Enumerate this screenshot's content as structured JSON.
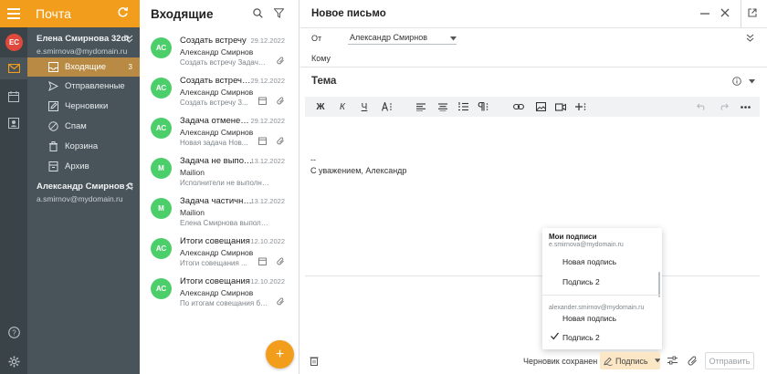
{
  "app": {
    "title": "Почта",
    "accent_color": "#f29d1b",
    "rail_initials": "ЕС"
  },
  "sidebar": {
    "accounts": [
      {
        "name": "Елена Смирнова 32dt",
        "email": "e.smirnova@mydomain.ru",
        "folders": [
          {
            "label": "Входящие",
            "count": "3",
            "icon": "inbox-icon"
          },
          {
            "label": "Отправленные",
            "icon": "send-icon"
          },
          {
            "label": "Черновики",
            "icon": "pencil-icon"
          },
          {
            "label": "Спам",
            "icon": "ban-icon"
          },
          {
            "label": "Корзина",
            "icon": "trash-icon"
          },
          {
            "label": "Архив",
            "icon": "archive-icon"
          }
        ]
      },
      {
        "name": "Александр Смирнов С",
        "email": "a.smirnov@mydomain.ru"
      }
    ]
  },
  "list": {
    "title": "Входящие",
    "messages": [
      {
        "initials": "АС",
        "subject": "Создать встречу",
        "date": "29.12.2022",
        "from": "Александр Смирнов",
        "preview": "Создать встречу Задача ..."
      },
      {
        "initials": "АС",
        "subject": "Создать встречу: ...",
        "date": "29.12.2022",
        "from": "Александр Смирнов",
        "preview": "Создать встречу 3..."
      },
      {
        "initials": "АС",
        "subject": "Задача отменена...",
        "date": "29.12.2022",
        "from": "Александр Смирнов",
        "preview": "Новая задача Нов..."
      },
      {
        "initials": "М",
        "subject": "Задача не выпол...",
        "date": "13.12.2022",
        "from": "Mailion",
        "preview": "Исполнители не выполнили зад..."
      },
      {
        "initials": "М",
        "subject": "Задача частично...",
        "date": "13.12.2022",
        "from": "Mailion",
        "preview": "Елена Смирнова выполнил зад..."
      },
      {
        "initials": "АС",
        "subject": "Итоги совещания",
        "date": "12.10.2022",
        "from": "Александр Смирнов",
        "preview": "Итоги совещания ..."
      },
      {
        "initials": "АС",
        "subject": "Итоги совещания",
        "date": "12.10.2022",
        "from": "Александр Смирнов",
        "preview": "По итогам совещания бы..."
      }
    ]
  },
  "compose": {
    "title": "Новое письмо",
    "from_label": "От",
    "from_value": "Александр Смирнов",
    "to_label": "Кому",
    "subject_placeholder": "Тема",
    "toolbar": {
      "bold": "Ж",
      "italic": "К",
      "underline": "Ч"
    },
    "signature_dash": "--",
    "signature_text": "С уважением, Александр"
  },
  "signature_menu": {
    "heading": "Мои подписи",
    "accounts": [
      {
        "email": "e.smirnova@mydomain.ru",
        "items": [
          "Новая подпись",
          "Подпись 2"
        ]
      },
      {
        "email": "alexander.smirnov@mydomain.ru",
        "items": [
          "Новая подпись",
          "Подпись 2"
        ]
      }
    ]
  },
  "footer": {
    "status": "Черновик сохранен",
    "signature_button": "Подпись",
    "send_button": "Отправить"
  }
}
